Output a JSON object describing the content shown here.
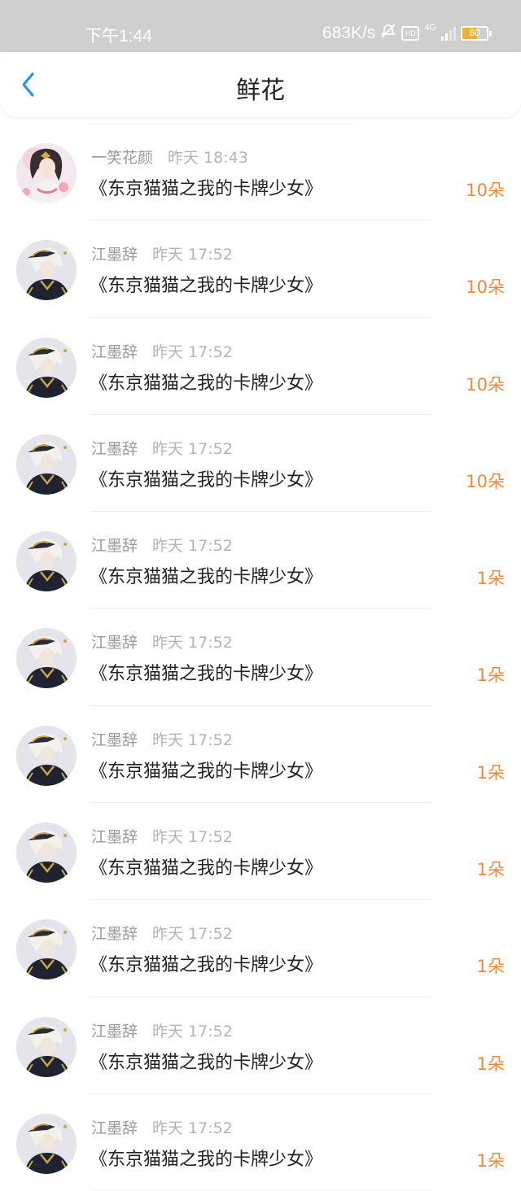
{
  "status_bar": {
    "time": "下午1:44",
    "net_speed": "683K/s",
    "net_type": "4G",
    "hd_label": "HD",
    "battery": "60",
    "battery_color": "#e8b13d"
  },
  "header": {
    "title": "鲜花",
    "back_icon": "chevron-left-icon",
    "accent_color": "#2f90e8"
  },
  "colors": {
    "count": "#f0883a"
  },
  "items": [
    {
      "user": "一笑花颜",
      "time": "昨天 18:43",
      "book": "《东京猫猫之我的卡牌少女》",
      "count": "10朵",
      "avatar": "female"
    },
    {
      "user": "江墨辞",
      "time": "昨天 17:52",
      "book": "《东京猫猫之我的卡牌少女》",
      "count": "10朵",
      "avatar": "male"
    },
    {
      "user": "江墨辞",
      "time": "昨天 17:52",
      "book": "《东京猫猫之我的卡牌少女》",
      "count": "10朵",
      "avatar": "male"
    },
    {
      "user": "江墨辞",
      "time": "昨天 17:52",
      "book": "《东京猫猫之我的卡牌少女》",
      "count": "10朵",
      "avatar": "male"
    },
    {
      "user": "江墨辞",
      "time": "昨天 17:52",
      "book": "《东京猫猫之我的卡牌少女》",
      "count": "1朵",
      "avatar": "male"
    },
    {
      "user": "江墨辞",
      "time": "昨天 17:52",
      "book": "《东京猫猫之我的卡牌少女》",
      "count": "1朵",
      "avatar": "male"
    },
    {
      "user": "江墨辞",
      "time": "昨天 17:52",
      "book": "《东京猫猫之我的卡牌少女》",
      "count": "1朵",
      "avatar": "male"
    },
    {
      "user": "江墨辞",
      "time": "昨天 17:52",
      "book": "《东京猫猫之我的卡牌少女》",
      "count": "1朵",
      "avatar": "male"
    },
    {
      "user": "江墨辞",
      "time": "昨天 17:52",
      "book": "《东京猫猫之我的卡牌少女》",
      "count": "1朵",
      "avatar": "male"
    },
    {
      "user": "江墨辞",
      "time": "昨天 17:52",
      "book": "《东京猫猫之我的卡牌少女》",
      "count": "1朵",
      "avatar": "male"
    },
    {
      "user": "江墨辞",
      "time": "昨天 17:52",
      "book": "《东京猫猫之我的卡牌少女》",
      "count": "1朵",
      "avatar": "male"
    }
  ]
}
